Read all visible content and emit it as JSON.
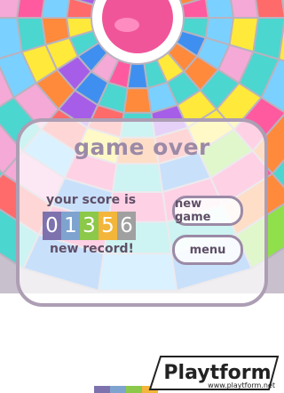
{
  "overlay": {
    "title": "game over",
    "score_label": "your score is",
    "score_digits": [
      "0",
      "1",
      "3",
      "5",
      "6"
    ],
    "digit_colors": [
      "#7e72ae",
      "#7fa3cf",
      "#8cc84a",
      "#f3b63a",
      "#a0a0a0"
    ],
    "record_text": "new record!",
    "new_game_label": "new game",
    "menu_label": "menu"
  },
  "watermark": {
    "brand": "Playtform",
    "url": "www.playtform.net"
  },
  "palette": [
    "#ff5aa0",
    "#ff8a3c",
    "#ffe93a",
    "#8fe04a",
    "#4bd6d0",
    "#3f8ff0",
    "#a65ee8",
    "#ff6b6b",
    "#f4a9d6",
    "#7ad1ff"
  ],
  "icons": [
    "pink-ball-icon"
  ]
}
